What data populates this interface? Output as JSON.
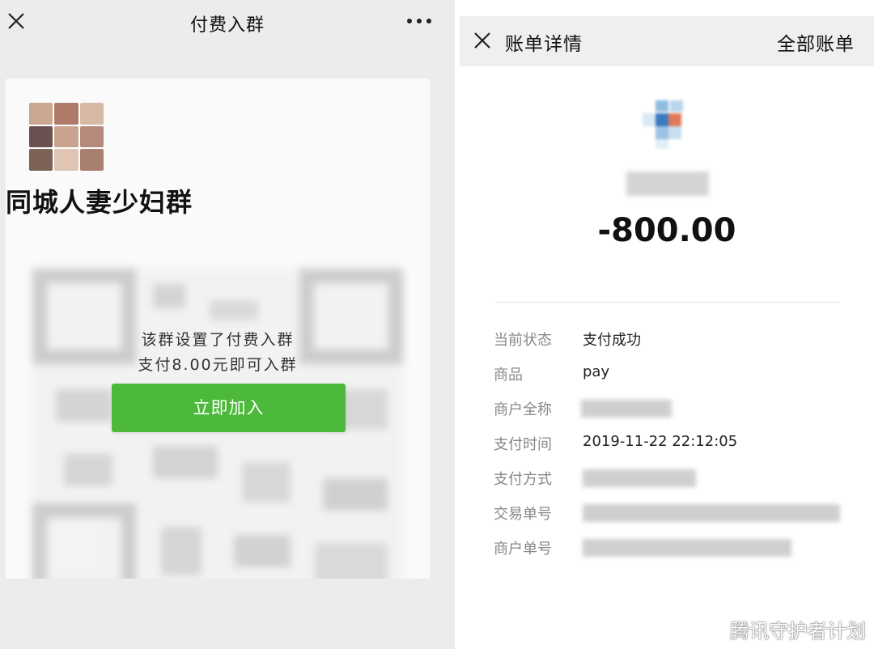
{
  "left": {
    "title": "付费入群",
    "group_name": "同城人妻少妇群",
    "note_line1": "该群设置了付费入群",
    "note_line2": "支付8.00元即可入群",
    "join_label": "立即加入",
    "colors": {
      "join": "#4cb93a"
    }
  },
  "right": {
    "title": "账单详情",
    "all_bills": "全部账单",
    "amount": "-800.00",
    "rows": [
      {
        "key": "当前状态",
        "value": "支付成功"
      },
      {
        "key": "商品",
        "value": "pay"
      },
      {
        "key": "商户全称",
        "value": ""
      },
      {
        "key": "支付时间",
        "value": "2019-11-22 22:12:05"
      },
      {
        "key": "支付方式",
        "value": ""
      },
      {
        "key": "交易单号",
        "value": ""
      },
      {
        "key": "商户单号",
        "value": ""
      }
    ]
  },
  "watermark": "腾讯守护者计划"
}
